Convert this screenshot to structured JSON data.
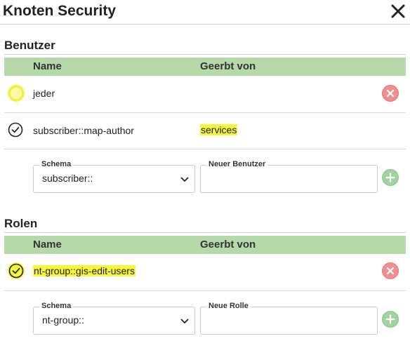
{
  "dialog": {
    "title": "Knoten Security"
  },
  "users_section": {
    "title": "Benutzer",
    "columns": {
      "name": "Name",
      "inherited": "Geerbt von"
    },
    "rows": [
      {
        "name": "jeder",
        "inherited": "",
        "icon": "empty-circle-icon"
      },
      {
        "name": "subscriber::map-author",
        "inherited": "services",
        "icon": "check-circle-icon"
      }
    ],
    "add_form": {
      "schema_label": "Schema",
      "schema_value": "subscriber::",
      "new_label": "Neuer Benutzer",
      "new_value": ""
    }
  },
  "roles_section": {
    "title": "Rolen",
    "columns": {
      "name": "Name",
      "inherited": "Geerbt von"
    },
    "rows": [
      {
        "name": "nt-group::gis-edit-users",
        "inherited": "",
        "icon": "check-circle-icon"
      }
    ],
    "add_form": {
      "schema_label": "Schema",
      "schema_value": "nt-group::",
      "new_label": "Neue Rolle",
      "new_value": ""
    }
  },
  "colors": {
    "header_bg": "#b6d9a9",
    "delete_red": "#ef8f8f",
    "add_green": "#9fd49f",
    "highlight": "#f5f53a"
  }
}
